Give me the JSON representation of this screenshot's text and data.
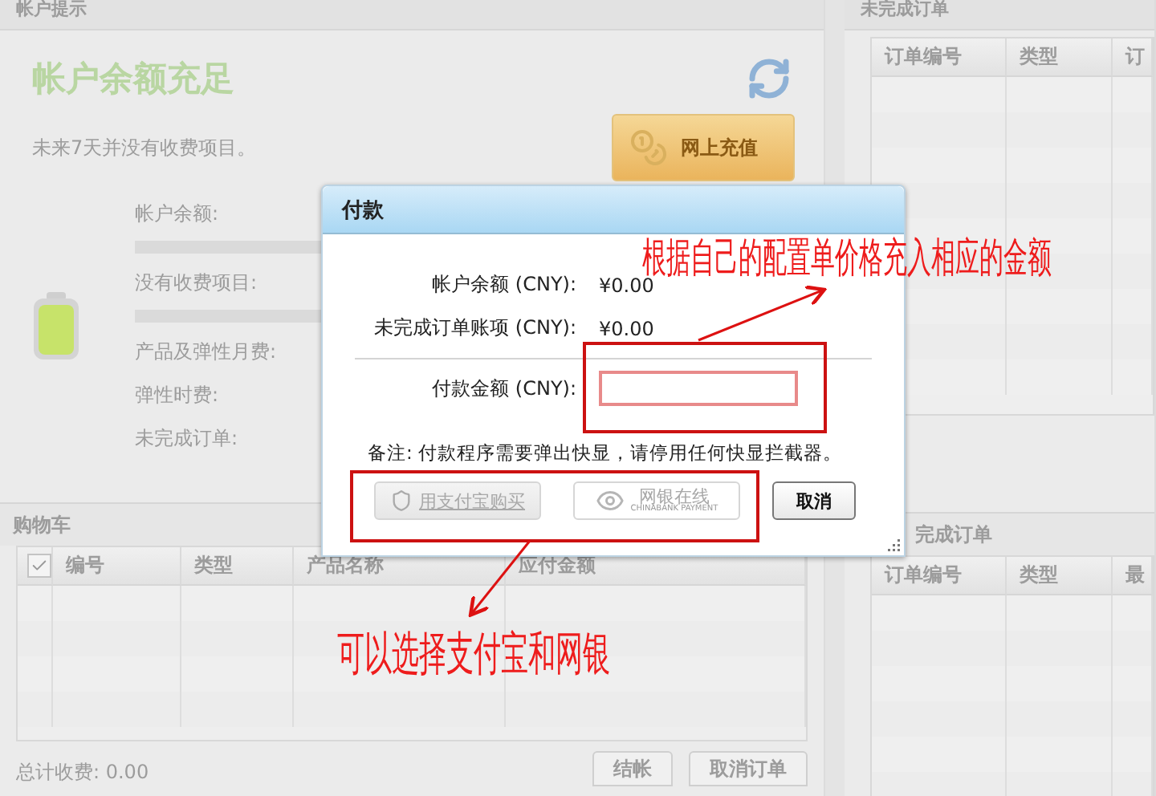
{
  "account_panel": {
    "title": "帐户提示",
    "status": "帐户余额充足",
    "notice": "未来7天并没有收费项目。",
    "recharge_button": "网上充值",
    "fields": [
      {
        "label": "帐户余额:",
        "kind": "bar"
      },
      {
        "label": "没有收费项目:",
        "kind": "bar"
      },
      {
        "label": "产品及弹性月费:",
        "kind": "text"
      },
      {
        "label": "弹性时费:",
        "kind": "text"
      },
      {
        "label": "未完成订单:",
        "kind": "text"
      }
    ]
  },
  "cart": {
    "title": "购物车",
    "select_all_checked": true,
    "columns": [
      "编号",
      "类型",
      "产品名称",
      "应付金额"
    ],
    "total": "总计收费: 0.00",
    "buttons": [
      "结帐",
      "取消订单"
    ]
  },
  "pending_orders": {
    "title": "未完成订单",
    "columns": [
      "订单编号",
      "类型",
      "订"
    ]
  },
  "pending_orders_lower": {
    "title": "完成订单",
    "columns": [
      "订单编号",
      "类型",
      "最"
    ]
  },
  "dialog": {
    "title": "付款",
    "rows": [
      {
        "label": "帐户余额 (CNY):",
        "value": "¥0.00"
      },
      {
        "label": "未完成订单账项 (CNY):",
        "value": "¥0.00"
      }
    ],
    "amount": {
      "label": "付款金额 (CNY):"
    },
    "note": "备注: 付款程序需要弹出快显，请停用任何快显拦截器。",
    "buttons": [
      {
        "label": "用支付宝购买",
        "kind": "alipay",
        "disabled": true
      },
      {
        "label": "网银在线",
        "sublabel": "CHINABANK PAYMENT",
        "kind": "chinabank",
        "disabled": true
      },
      {
        "label": "取消",
        "kind": "plain",
        "disabled": false
      }
    ]
  },
  "annotations": [
    {
      "text": "根据自己的配置单价格充入相应的金额"
    },
    {
      "text": "可以选择支付宝和网银"
    }
  ]
}
